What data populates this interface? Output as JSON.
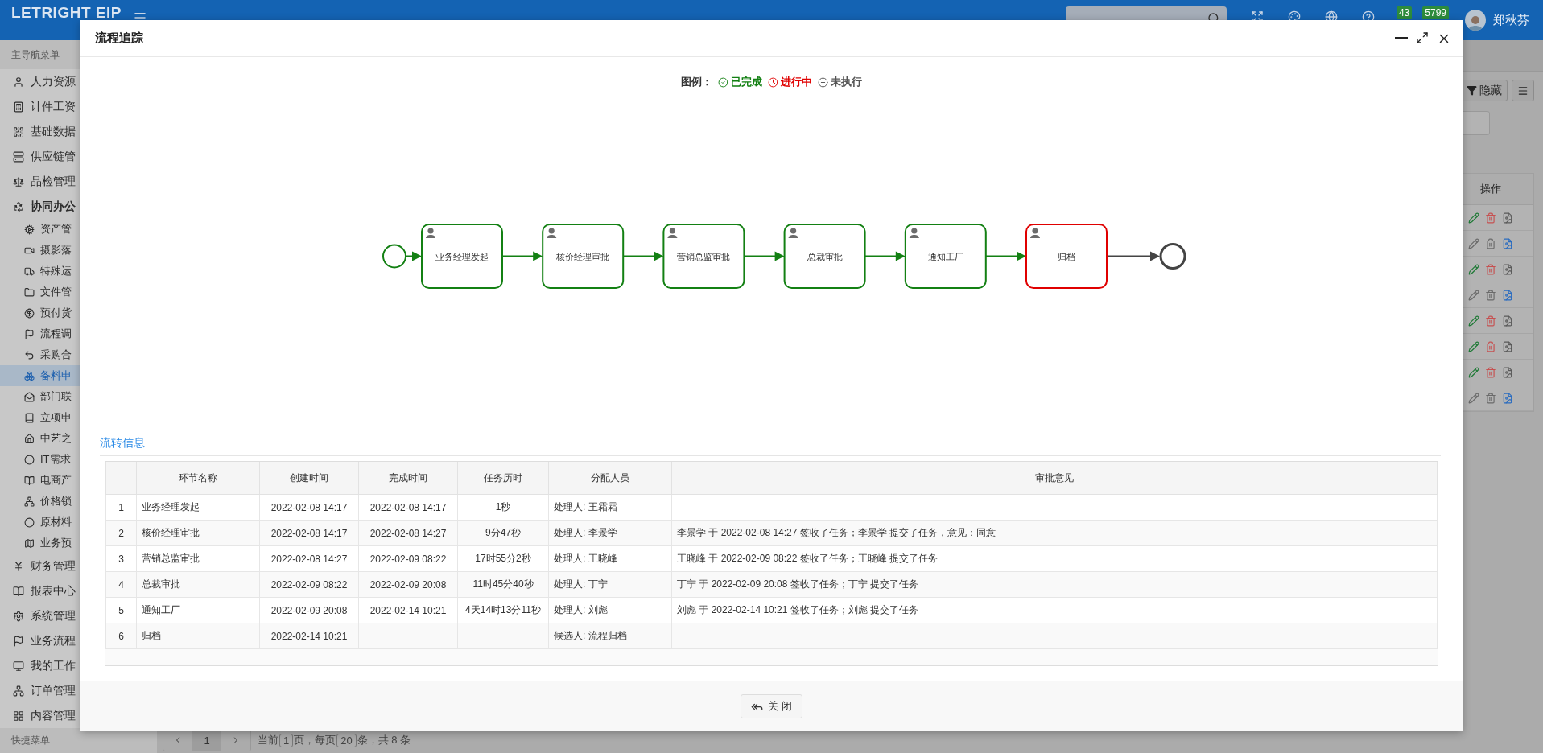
{
  "app": {
    "logo": "LETRIGHT EIP",
    "badges": [
      {
        "count": "43"
      },
      {
        "count": "5799"
      }
    ],
    "user": "郑秋芬"
  },
  "sidebar": {
    "header": "主导航菜单",
    "footer": "快捷菜单",
    "items": [
      {
        "label": "人力资源",
        "selected": false
      },
      {
        "label": "计件工资",
        "selected": false
      },
      {
        "label": "基础数据",
        "selected": false
      },
      {
        "label": "供应链管",
        "selected": false
      },
      {
        "label": "品检管理",
        "selected": false
      },
      {
        "label": "协同办公",
        "selected": false,
        "expanded": true,
        "children": [
          {
            "label": "资产管",
            "selected": false
          },
          {
            "label": "摄影落",
            "selected": false
          },
          {
            "label": "特殊运",
            "selected": false
          },
          {
            "label": "文件管",
            "selected": false
          },
          {
            "label": "预付货",
            "selected": false
          },
          {
            "label": "流程调",
            "selected": false
          },
          {
            "label": "采购合",
            "selected": false
          },
          {
            "label": "备料申",
            "selected": true
          },
          {
            "label": "部门联",
            "selected": false
          },
          {
            "label": "立项申",
            "selected": false
          },
          {
            "label": "中艺之",
            "selected": false
          },
          {
            "label": "IT需求",
            "selected": false
          },
          {
            "label": "电商产",
            "selected": false
          },
          {
            "label": "价格锁",
            "selected": false
          },
          {
            "label": "原材料",
            "selected": false
          },
          {
            "label": "业务预",
            "selected": false
          }
        ]
      },
      {
        "label": "财务管理",
        "selected": false
      },
      {
        "label": "报表中心",
        "selected": false
      },
      {
        "label": "系统管理",
        "selected": false
      },
      {
        "label": "业务流程",
        "selected": false
      },
      {
        "label": "我的工作",
        "selected": false
      },
      {
        "label": "订单管理",
        "selected": false
      },
      {
        "label": "内容管理",
        "selected": false
      }
    ]
  },
  "background": {
    "toolbar_button": "隐藏",
    "ops_header": "操作",
    "ops_rows": [
      {
        "editable": true
      },
      {
        "editable": false
      },
      {
        "editable": true
      },
      {
        "editable": false
      },
      {
        "editable": true
      },
      {
        "editable": true
      },
      {
        "editable": true
      },
      {
        "editable": false
      }
    ],
    "pager": {
      "page": "1",
      "prefix": "当前",
      "current": "1",
      "mid": "页，每页",
      "size": "20",
      "suffix": "条，共 8 条"
    }
  },
  "dialog": {
    "title": "流程追踪",
    "legend": {
      "label": "图例：",
      "items": [
        {
          "color": "#138013",
          "label": "已完成"
        },
        {
          "color": "#e00000",
          "label": "进行中"
        },
        {
          "color": "#555555",
          "label": "未执行"
        }
      ]
    },
    "flow": {
      "start": {
        "color": "#138013"
      },
      "end": {
        "color": "#444444"
      },
      "nodes": [
        {
          "label": "业务经理发起",
          "color": "#138013"
        },
        {
          "label": "核价经理审批",
          "color": "#138013"
        },
        {
          "label": "营销总监审批",
          "color": "#138013"
        },
        {
          "label": "总裁审批",
          "color": "#138013"
        },
        {
          "label": "通知工厂",
          "color": "#138013"
        },
        {
          "label": "归档",
          "color": "#e00000"
        }
      ]
    },
    "section_title": "流转信息",
    "table": {
      "columns": [
        "环节名称",
        "创建时间",
        "完成时间",
        "任务历时",
        "分配人员",
        "审批意见"
      ],
      "rows": [
        {
          "no": "1",
          "name": "业务经理发起",
          "created": "2022-02-08 14:17",
          "finished": "2022-02-08 14:17",
          "duration": "1秒",
          "assignee": "处理人: 王霜霜"
        },
        {
          "no": "2",
          "name": "核价经理审批",
          "created": "2022-02-08 14:17",
          "finished": "2022-02-08 14:27",
          "duration": "9分47秒",
          "assignee": "处理人: 李景学",
          "opinion": "李景学 于 2022-02-08 14:27 签收了任务；李景学 提交了任务，意见：同意"
        },
        {
          "no": "3",
          "name": "营销总监审批",
          "created": "2022-02-08 14:27",
          "finished": "2022-02-09 08:22",
          "duration": "17时55分2秒",
          "assignee": "处理人: 王晓峰",
          "opinion": "王晓峰 于 2022-02-09 08:22 签收了任务；王晓峰 提交了任务"
        },
        {
          "no": "4",
          "name": "总裁审批",
          "created": "2022-02-09 08:22",
          "finished": "2022-02-09 20:08",
          "duration": "11时45分40秒",
          "assignee": "处理人: 丁宁",
          "opinion": "丁宁 于 2022-02-09 20:08 签收了任务；丁宁 提交了任务"
        },
        {
          "no": "5",
          "name": "通知工厂",
          "created": "2022-02-09 20:08",
          "finished": "2022-02-14 10:21",
          "duration": "4天14时13分11秒",
          "assignee": "处理人: 刘彪",
          "opinion": "刘彪 于 2022-02-14 10:21 签收了任务；刘彪 提交了任务"
        },
        {
          "no": "6",
          "name": "归档",
          "created": "2022-02-14 10:21",
          "assignee": "候选人: 流程归档"
        }
      ]
    },
    "close_button": "关 闭"
  }
}
